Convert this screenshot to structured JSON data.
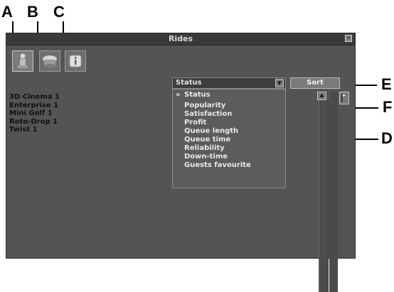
{
  "callouts": {
    "a": "A",
    "b": "B",
    "c": "C",
    "d": "D",
    "e": "E",
    "f": "F"
  },
  "window": {
    "title": "Rides"
  },
  "tabs": [
    "rides-tab",
    "refreshment-tab",
    "info-tab"
  ],
  "dropdown": {
    "selected": "Status"
  },
  "sort_label": "Sort",
  "rides": [
    "3D Cinema 1",
    "Enterprise 1",
    "Mini Golf 1",
    "Roto-Drop 1",
    "Twist 1"
  ],
  "menu": {
    "check": "»",
    "items": [
      "Status",
      "Popularity",
      "Satisfaction",
      "Profit",
      "Queue length",
      "Queue time",
      "Reliability",
      "Down-time",
      "Guests favourite"
    ]
  },
  "colors": {
    "window_bg": "#545454",
    "menu_bg": "#5c5c5c",
    "title_bar": "#3a3a3a"
  }
}
